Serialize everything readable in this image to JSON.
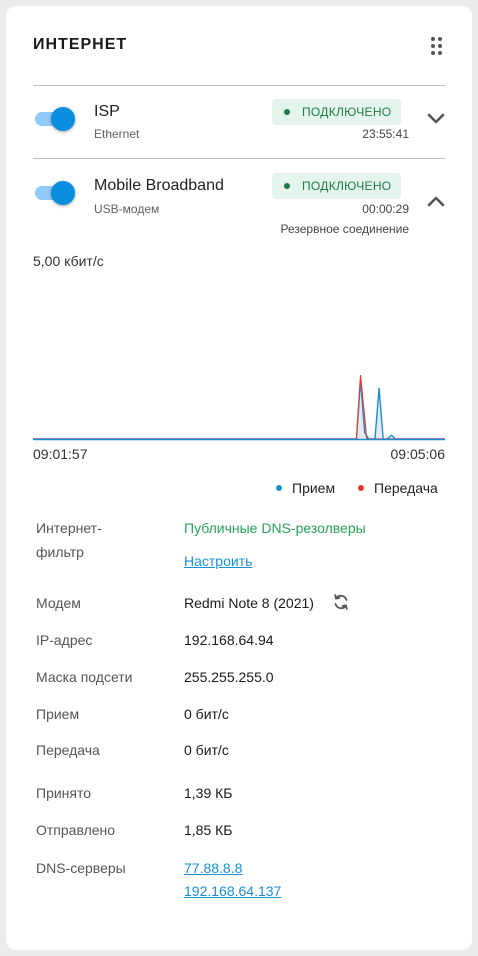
{
  "title": "ИНТЕРНЕТ",
  "connections": [
    {
      "name": "ISP",
      "type": "Ethernet",
      "status": "ПОДКЛЮЧЕНО",
      "uptime": "23:55:41",
      "enabled": true,
      "expanded": false
    },
    {
      "name": "Mobile Broadband",
      "type": "USB-модем",
      "status": "ПОДКЛЮЧЕНО",
      "uptime": "00:00:29",
      "role": "Резервное соединение",
      "enabled": true,
      "expanded": true
    }
  ],
  "chart": {
    "ymax_label": "5,00 кбит/с",
    "x_start": "09:01:57",
    "x_end": "09:05:06"
  },
  "chart_data": {
    "type": "area",
    "title": "",
    "xlabel": "",
    "ylabel": "",
    "ylim": [
      0,
      5.0
    ],
    "x_range": [
      "09:01:57",
      "09:05:06"
    ],
    "series": [
      {
        "name": "Прием",
        "color": "#1a8fd8",
        "points": [
          [
            0,
            0
          ],
          [
            0.785,
            0
          ],
          [
            0.795,
            1.8
          ],
          [
            0.805,
            0.2
          ],
          [
            0.815,
            0
          ],
          [
            0.83,
            0
          ],
          [
            0.84,
            1.55
          ],
          [
            0.85,
            0
          ],
          [
            0.86,
            0
          ],
          [
            0.87,
            0.12
          ],
          [
            0.88,
            0
          ],
          [
            1,
            0
          ]
        ]
      },
      {
        "name": "Передача",
        "color": "#e53935",
        "points": [
          [
            0,
            0
          ],
          [
            0.785,
            0
          ],
          [
            0.795,
            1.95
          ],
          [
            0.81,
            0
          ],
          [
            1,
            0
          ]
        ]
      }
    ]
  },
  "legend": [
    {
      "label": "Прием",
      "color": "#1a8fd8"
    },
    {
      "label": "Передача",
      "color": "#e53935"
    }
  ],
  "details": {
    "filter_label_1": "Интернет-",
    "filter_label_2": "фильтр",
    "filter_value": "Публичные DNS-резолверы",
    "filter_link": "Настроить",
    "modem_label": "Модем",
    "modem_value": "Redmi Note 8 (2021)",
    "ip_label": "IP-адрес",
    "ip_value": "192.168.64.94",
    "mask_label": "Маска подсети",
    "mask_value": "255.255.255.0",
    "rx_label": "Прием",
    "rx_value": "0 бит/с",
    "tx_label": "Передача",
    "tx_value": "0 бит/с",
    "received_label": "Принято",
    "received_value": "1,39 КБ",
    "sent_label": "Отправлено",
    "sent_value": "1,85 КБ",
    "dns_label": "DNS-серверы",
    "dns_servers": [
      "77.88.8.8",
      "192.168.64.137"
    ]
  },
  "colors": {
    "accent": "#0b8ee0",
    "status_green": "#1f7a45",
    "badge_bg": "#e3f5ec"
  }
}
